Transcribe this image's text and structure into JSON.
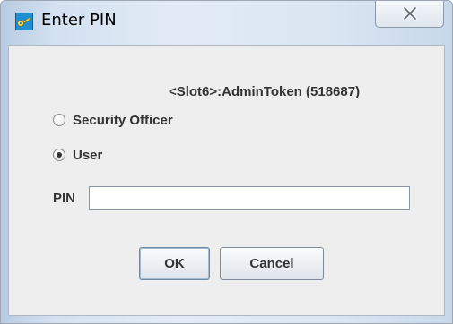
{
  "window": {
    "title": "Enter PIN",
    "icon": "key-icon",
    "close_icon": "close-icon"
  },
  "dialog": {
    "token_label": "<Slot6>:AdminToken (518687)",
    "roles": [
      {
        "label": "Security Officer",
        "selected": false
      },
      {
        "label": "User",
        "selected": true
      }
    ],
    "pin": {
      "label": "PIN",
      "value": ""
    },
    "buttons": {
      "ok": "OK",
      "cancel": "Cancel"
    }
  },
  "colors": {
    "title_bar": "#d3e1f0",
    "client_bg": "#eeeeee",
    "key_icon": "#2ea0d8"
  }
}
